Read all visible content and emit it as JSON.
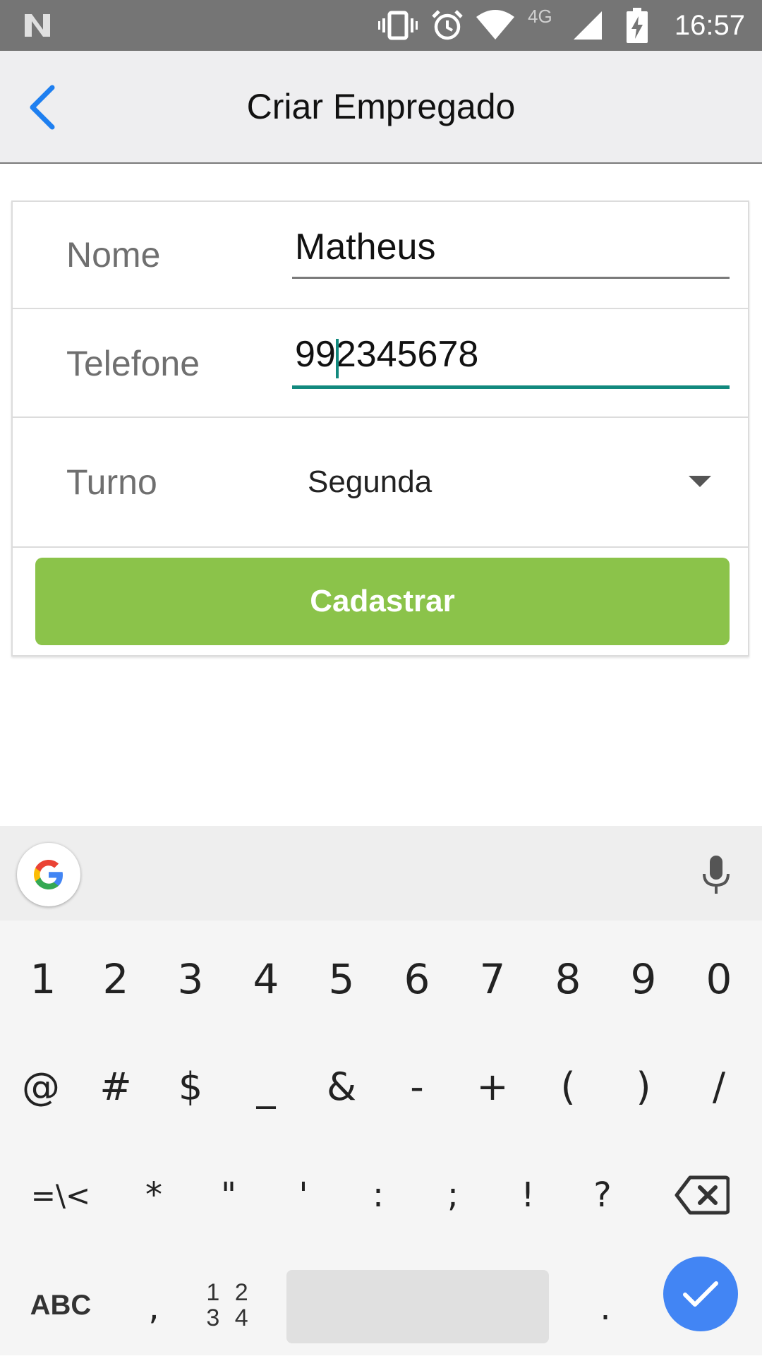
{
  "status_bar": {
    "time": "16:57",
    "network_type": "4G",
    "icons": [
      "n-logo-icon",
      "vibrate-icon",
      "alarm-icon",
      "wifi-icon",
      "signal-icon",
      "battery-charging-icon"
    ]
  },
  "app_bar": {
    "title": "Criar Empregado",
    "back_icon": "chevron-left-icon"
  },
  "form": {
    "nome": {
      "label": "Nome",
      "value": "Matheus"
    },
    "telefone": {
      "label": "Telefone",
      "value": "992345678"
    },
    "turno": {
      "label": "Turno",
      "selected": "Segunda"
    },
    "submit_label": "Cadastrar"
  },
  "keyboard": {
    "row1": [
      "1",
      "2",
      "3",
      "4",
      "5",
      "6",
      "7",
      "8",
      "9",
      "0"
    ],
    "row2": [
      "@",
      "#",
      "$",
      "_",
      "&",
      "-",
      "+",
      "(",
      ")",
      "/"
    ],
    "row3": [
      "=\\<",
      "*",
      "\"",
      "'",
      ":",
      ";",
      "!",
      "?"
    ],
    "abc_label": "ABC",
    "comma": ",",
    "numpad_label_top": "1 2",
    "numpad_label_bottom": "3 4",
    "period": "."
  },
  "colors": {
    "status_bar": "#757575",
    "app_bar": "#eeeef0",
    "accent_back": "#1e7ff0",
    "focus_underline": "#12897e",
    "submit_button": "#8bc34a",
    "enter_key": "#4285f4"
  }
}
